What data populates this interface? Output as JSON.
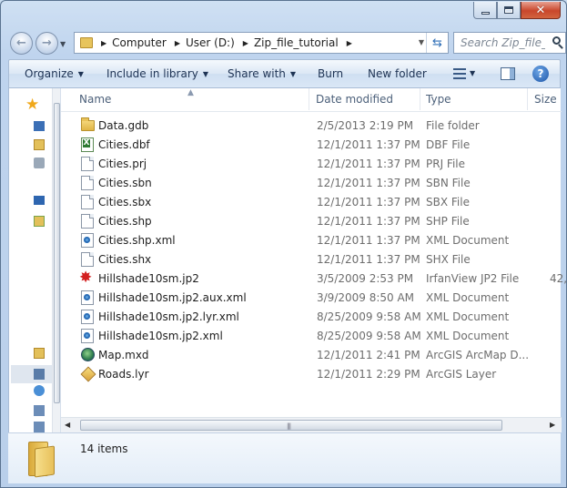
{
  "address_bar": {
    "crumbs": [
      "Computer",
      "User (D:)",
      "Zip_file_tutorial"
    ]
  },
  "search": {
    "placeholder": "Search Zip_file_..."
  },
  "command_bar": {
    "organize": "Organize",
    "include_in_library": "Include in library",
    "share_with": "Share with",
    "burn": "Burn",
    "new_folder": "New folder"
  },
  "columns": {
    "name": "Name",
    "date_modified": "Date modified",
    "type": "Type",
    "size": "Size"
  },
  "files": [
    {
      "icon": "folder",
      "name": "Data.gdb",
      "date": "2/5/2013 2:19 PM",
      "type": "File folder",
      "size": ""
    },
    {
      "icon": "dbf",
      "name": "Cities.dbf",
      "date": "12/1/2011 1:37 PM",
      "type": "DBF File",
      "size": ""
    },
    {
      "icon": "doc",
      "name": "Cities.prj",
      "date": "12/1/2011 1:37 PM",
      "type": "PRJ File",
      "size": ""
    },
    {
      "icon": "doc",
      "name": "Cities.sbn",
      "date": "12/1/2011 1:37 PM",
      "type": "SBN File",
      "size": ""
    },
    {
      "icon": "doc",
      "name": "Cities.sbx",
      "date": "12/1/2011 1:37 PM",
      "type": "SBX File",
      "size": ""
    },
    {
      "icon": "doc",
      "name": "Cities.shp",
      "date": "12/1/2011 1:37 PM",
      "type": "SHP File",
      "size": ""
    },
    {
      "icon": "xml",
      "name": "Cities.shp.xml",
      "date": "12/1/2011 1:37 PM",
      "type": "XML Document",
      "size": ""
    },
    {
      "icon": "doc",
      "name": "Cities.shx",
      "date": "12/1/2011 1:37 PM",
      "type": "SHX File",
      "size": ""
    },
    {
      "icon": "jp2",
      "name": "Hillshade10sm.jp2",
      "date": "3/5/2009 2:53 PM",
      "type": "IrfanView JP2 File",
      "size": "42,"
    },
    {
      "icon": "xml",
      "name": "Hillshade10sm.jp2.aux.xml",
      "date": "3/9/2009 8:50 AM",
      "type": "XML Document",
      "size": ""
    },
    {
      "icon": "xml",
      "name": "Hillshade10sm.jp2.lyr.xml",
      "date": "8/25/2009 9:58 AM",
      "type": "XML Document",
      "size": ""
    },
    {
      "icon": "xml",
      "name": "Hillshade10sm.jp2.xml",
      "date": "8/25/2009 9:58 AM",
      "type": "XML Document",
      "size": ""
    },
    {
      "icon": "mxd",
      "name": "Map.mxd",
      "date": "12/1/2011 2:41 PM",
      "type": "ArcGIS ArcMap D...",
      "size": ""
    },
    {
      "icon": "lyr",
      "name": "Roads.lyr",
      "date": "12/1/2011 2:29 PM",
      "type": "ArcGIS Layer",
      "size": ""
    }
  ],
  "details": {
    "item_count": "14 items"
  }
}
